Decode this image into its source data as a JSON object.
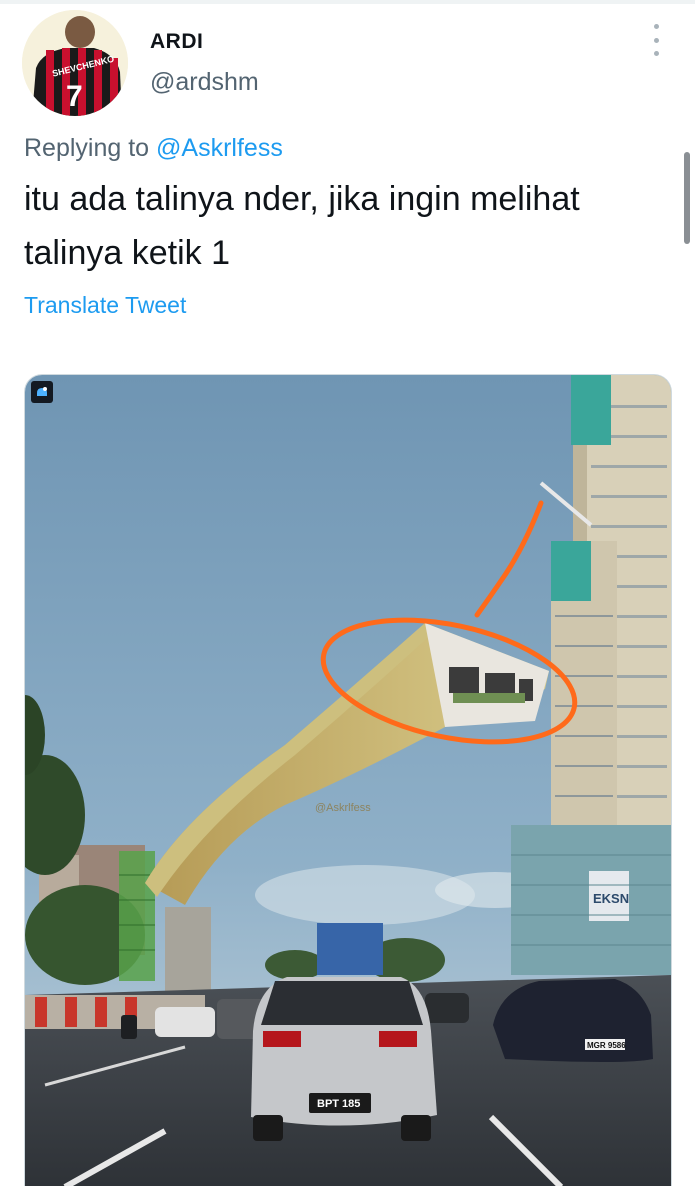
{
  "tweet": {
    "author": {
      "display_name": "ARDI",
      "handle": "@ardshm",
      "avatar_jersey_name": "SHEVCHENKO",
      "avatar_jersey_number": "7"
    },
    "replying_prefix": "Replying to",
    "replying_to": "@Askrlfess",
    "text": "itu ada talinya nder, jika ingin melihat talinya ketik 1",
    "translate_label": "Translate Tweet",
    "media": {
      "watermark_text": "@Askrlfess",
      "plates": [
        "BPT 185",
        "MGR 9586"
      ],
      "building_sign": "EKSN"
    }
  },
  "colors": {
    "link": "#1d9bf0",
    "secondary_text": "#536471",
    "primary_text": "#0f1419",
    "annotation": "#ff6a1a"
  },
  "icons": [
    "more-vertical-icon",
    "media-watermark-icon"
  ]
}
